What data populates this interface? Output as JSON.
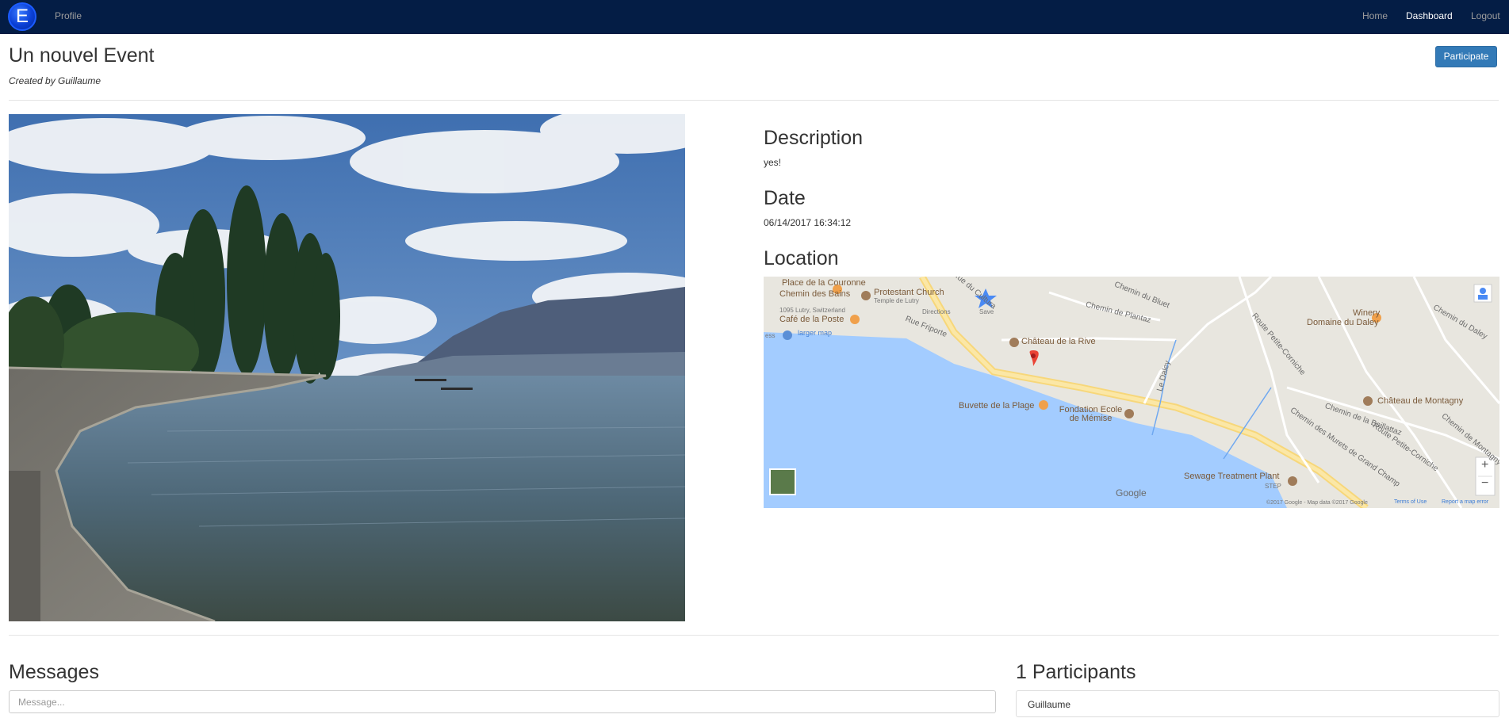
{
  "navbar": {
    "logo_letter": "E",
    "profile": "Profile",
    "home": "Home",
    "dashboard": "Dashboard",
    "logout": "Logout"
  },
  "event": {
    "title": "Un nouvel Event",
    "created_by": "Created by Guillaume",
    "participate_label": "Participate"
  },
  "details": {
    "description_heading": "Description",
    "description": "yes!",
    "date_heading": "Date",
    "date": "06/14/2017 16:34:12",
    "location_heading": "Location"
  },
  "map": {
    "labels": {
      "place_couronne": "Place de la Couronne",
      "chemin_bains": "Chemin des Bains",
      "protestant_church": "Protestant Church",
      "temple_lutry": "Temple de Lutry",
      "address": "1095 Lutry, Switzerland",
      "cafe_poste": "Café de la Poste",
      "directions": "Directions",
      "save": "Save",
      "larger_map": "larger map",
      "ess": "ess",
      "rue_friporte": "Rue Friporte",
      "chateau_rive": "Château de la Rive",
      "chemin_bluet": "Chemin du Bluet",
      "chemin_plantaz": "Chemin de Plantaz",
      "winery": "Winery",
      "domaine_daley": "Domaine du Daley",
      "chemin_daley": "Chemin du Daley",
      "route_corniche": "Route Petite-Corniche",
      "rue_cultura": "Rue du Cultura",
      "le_daley": "Le Daley",
      "buvette": "Buvette de la Plage",
      "fondation": "Fondation Ecole de Mémise",
      "chateau_montagny": "Château de Montagny",
      "chemin_boillattaz": "Chemin de la Boillattaz",
      "chemin_murets": "Chemin des Murets de Grand Champ",
      "route_corniche_2": "Route Petite-Corniche",
      "chemin_montagny": "Chemin de Montagny",
      "sewage": "Sewage Treatment Plant",
      "step": "STEP",
      "google": "Google",
      "attribution": "©2017 Google - Map data ©2017 Google",
      "terms": "Terms of Use",
      "report": "Report a map error",
      "zoom_in": "+",
      "zoom_out": "−"
    }
  },
  "messages": {
    "heading": "Messages",
    "placeholder": "Message..."
  },
  "participants": {
    "heading": "1 Participants",
    "list": [
      "Guillaume"
    ]
  }
}
